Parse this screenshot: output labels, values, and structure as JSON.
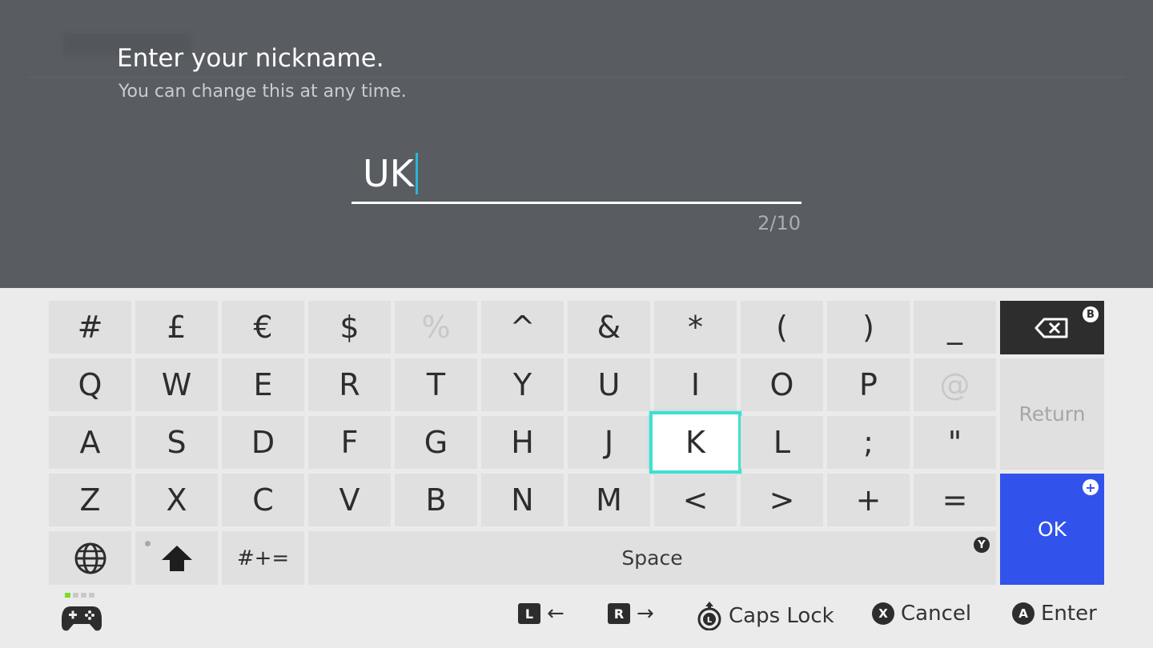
{
  "header": {
    "title": "Enter your nickname.",
    "subtitle": "You can change this at any time."
  },
  "input": {
    "value": "UK",
    "counter": "2/10"
  },
  "keyboard": {
    "row1": [
      "#",
      "£",
      "€",
      "$",
      "%",
      "^",
      "&",
      "*",
      "(",
      ")",
      "_"
    ],
    "row2": [
      "Q",
      "W",
      "E",
      "R",
      "T",
      "Y",
      "U",
      "I",
      "O",
      "P",
      "@"
    ],
    "row3": [
      "A",
      "S",
      "D",
      "F",
      "G",
      "H",
      "J",
      "K",
      "L",
      ";",
      "\""
    ],
    "row4": [
      "Z",
      "X",
      "C",
      "V",
      "B",
      "N",
      "M",
      "<",
      ">",
      "+",
      "="
    ],
    "selected_key": "K",
    "disabled_keys": [
      "%",
      "@"
    ],
    "symbols_label": "#+=",
    "space_label": "Space",
    "return_label": "Return",
    "ok_label": "OK",
    "badges": {
      "backspace": "B",
      "ok": "+",
      "space": "Y"
    }
  },
  "footer": {
    "hints": [
      {
        "button": "L",
        "label": "←"
      },
      {
        "button": "R",
        "label": "→"
      },
      {
        "button": "L",
        "label": "Caps Lock"
      },
      {
        "button": "X",
        "label": "Cancel"
      },
      {
        "button": "A",
        "label": "Enter"
      }
    ]
  },
  "colors": {
    "top_panel": "#595d62",
    "keyboard_bg": "#ebebeb",
    "key_bg": "#e0e0e0",
    "selection": "#3fe0d0",
    "ok_blue": "#3153ec",
    "caret": "#29b6d8",
    "backspace_bg": "#2d2d2d"
  }
}
